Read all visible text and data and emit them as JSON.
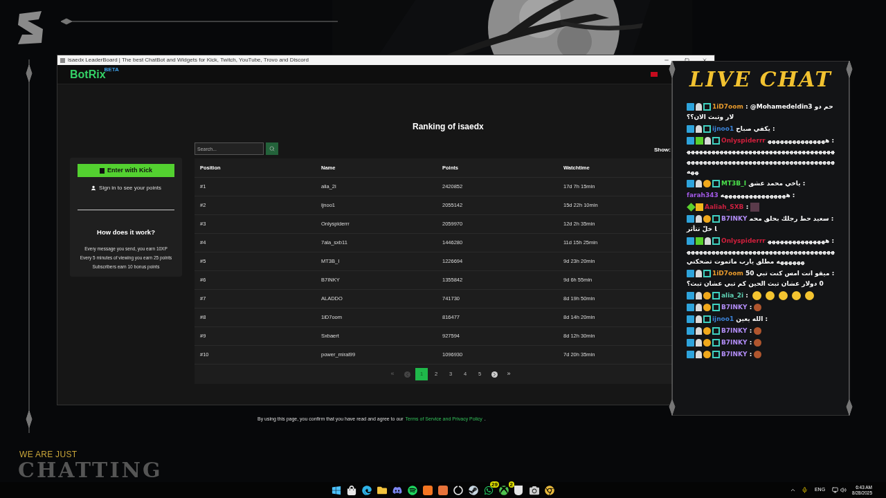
{
  "overlay": {
    "tagline": "WE ARE JUST",
    "title": "CHATTING"
  },
  "browser": {
    "title": "isaedx LeaderBoard | The best ChatBot and Widgets for Kick, Twitch, YouTube, Trovo and Discord",
    "logo": "BotRix",
    "logo_badge": "BETA"
  },
  "sidebar": {
    "login_button": "Enter with Kick",
    "sign_in": "Sign in to see your points",
    "heading": "How does it work?",
    "rules": [
      "Every message you send, you earn 10XP",
      "Every 5 minutes of viewing you earn 25 points",
      "Subscribers earn 10 bonus points"
    ]
  },
  "ranking": {
    "title": "Ranking of isaedx",
    "search": {
      "placeholder": "Search..."
    },
    "show_label": "Show:",
    "columns": [
      "Position",
      "Name",
      "Points",
      "Watchtime"
    ],
    "rows": [
      [
        "#1",
        "alia_2i",
        "2420852",
        "17d 7h 15min"
      ],
      [
        "#2",
        "ijnoo1",
        "2055142",
        "15d 22h 10min"
      ],
      [
        "#3",
        "Onlyspiderrr",
        "2059970",
        "12d 2h 35min"
      ],
      [
        "#4",
        "7ala_sxb11",
        "1446280",
        "11d 15h 25min"
      ],
      [
        "#5",
        "MT3B_I",
        "1226694",
        "9d 23h 20min"
      ],
      [
        "#6",
        "B7INKY",
        "1355842",
        "9d 6h 55min"
      ],
      [
        "#7",
        "ALADDO",
        "741730",
        "8d 19h 50min"
      ],
      [
        "#8",
        "1iD7oom",
        "816477",
        "8d 14h 20min"
      ],
      [
        "#9",
        "Sxbaert",
        "927594",
        "8d 12h 30min"
      ],
      [
        "#10",
        "power_miral99",
        "1096930",
        "7d 20h 35min"
      ]
    ],
    "pagination": {
      "first": "«",
      "last": "»",
      "prev_disabled": true,
      "next_disabled": false,
      "pages": [
        {
          "label": "1",
          "selected": true
        },
        {
          "label": "2",
          "selected": false
        },
        {
          "label": "3",
          "selected": false
        },
        {
          "label": "4",
          "selected": false
        },
        {
          "label": "5",
          "selected": false
        }
      ]
    }
  },
  "footer": {
    "text": "By using this page, you confirm that you have read and agree to our",
    "link": "Terms of Service and Privacy Policy",
    "end": "."
  },
  "chat": {
    "title": "LIVE CHAT",
    "messages": [
      {
        "badges": [
          {
            "kind": "mod"
          },
          {
            "kind": "sub"
          },
          {
            "kind": "og"
          }
        ],
        "user": "1iD7oom",
        "color": "#e89a2c",
        "text": ": @Mohamedeldin3 حم دولار وتبث الان؟؟"
      },
      {
        "badges": [
          {
            "kind": "mod"
          },
          {
            "kind": "sub"
          },
          {
            "kind": "og"
          }
        ],
        "user": "ijnoo1",
        "color": "#3b82d6",
        "text": ": يكفي صباح"
      },
      {
        "badges": [
          {
            "kind": "mod"
          },
          {
            "kind": "gift"
          },
          {
            "kind": "sub"
          },
          {
            "kind": "og"
          }
        ],
        "user": "Onlyspiderrr",
        "color": "#d11f3c",
        "text": ": هههههههههههههههههههههههههههههههههههههههههههههههههههههههههههههههههههههههههههههههههههههههههه"
      },
      {
        "badges": [
          {
            "kind": "mod"
          },
          {
            "kind": "sub"
          },
          {
            "kind": "tier"
          },
          {
            "kind": "og"
          }
        ],
        "user": "MT3B_I",
        "color": "#4ade4a",
        "text": ": ياخي محمد عشق"
      },
      {
        "user": "farah343",
        "color": "#a259e6",
        "text": ": ههههههههههههههههه"
      },
      {
        "badges": [
          {
            "kind": "vip"
          },
          {
            "kind": "crown"
          }
        ],
        "user": "Aaliah_SXB",
        "color": "#c8203f",
        "text": ":",
        "emotes": [
          {
            "kind": "pixel"
          }
        ]
      },
      {
        "badges": [
          {
            "kind": "mod"
          },
          {
            "kind": "sub"
          },
          {
            "kind": "tier"
          },
          {
            "kind": "og"
          }
        ],
        "user": "B7INKY",
        "color": "#b18cf5",
        "text": ": سعيد حط رجلك بحلق محما خلّ تتأثر"
      },
      {
        "badges": [
          {
            "kind": "mod"
          },
          {
            "kind": "gift"
          },
          {
            "kind": "sub"
          },
          {
            "kind": "og"
          }
        ],
        "user": "Onlyspiderrr",
        "color": "#d11f3c",
        "text": ": هههههههههههههههههههههههههههههههههههههههههههههههههههههههههه مطلق يارب ماتموت تضحكني"
      },
      {
        "badges": [
          {
            "kind": "mod"
          },
          {
            "kind": "sub"
          },
          {
            "kind": "og"
          }
        ],
        "user": "1iD7oom",
        "color": "#e89a2c",
        "text": ": ميقو انت امس كنت تبي 500 دولار عشان تبث الحين كم تبي عشان تبث؟"
      },
      {
        "badges": [
          {
            "kind": "mod"
          },
          {
            "kind": "sub"
          },
          {
            "kind": "tier"
          },
          {
            "kind": "og"
          }
        ],
        "user": "alia_2i",
        "color": "#5fd3b5",
        "text": ":",
        "emotes": [
          {
            "kind": "hug"
          },
          {
            "kind": "hug"
          },
          {
            "kind": "hug"
          },
          {
            "kind": "hug"
          },
          {
            "kind": "hug"
          }
        ]
      },
      {
        "badges": [
          {
            "kind": "mod"
          },
          {
            "kind": "sub"
          },
          {
            "kind": "tier"
          },
          {
            "kind": "og"
          }
        ],
        "user": "B7INKY",
        "color": "#b18cf5",
        "text": ":",
        "emotes": [
          {
            "kind": "sticker"
          }
        ]
      },
      {
        "badges": [
          {
            "kind": "mod"
          },
          {
            "kind": "sub"
          },
          {
            "kind": "og"
          }
        ],
        "user": "ijnoo1",
        "color": "#3b82d6",
        "text": ": الله يعين"
      },
      {
        "badges": [
          {
            "kind": "mod"
          },
          {
            "kind": "sub"
          },
          {
            "kind": "tier"
          },
          {
            "kind": "og"
          }
        ],
        "user": "B7INKY",
        "color": "#b18cf5",
        "text": ":",
        "emotes": [
          {
            "kind": "sticker"
          }
        ]
      },
      {
        "badges": [
          {
            "kind": "mod"
          },
          {
            "kind": "sub"
          },
          {
            "kind": "tier"
          },
          {
            "kind": "og"
          }
        ],
        "user": "B7INKY",
        "color": "#b18cf5",
        "text": ":",
        "emotes": [
          {
            "kind": "sticker"
          }
        ]
      },
      {
        "badges": [
          {
            "kind": "mod"
          },
          {
            "kind": "sub"
          },
          {
            "kind": "tier"
          },
          {
            "kind": "og"
          }
        ],
        "user": "B7INKY",
        "color": "#b18cf5",
        "text": ":",
        "emotes": [
          {
            "kind": "sticker"
          }
        ]
      }
    ]
  },
  "taskbar": {
    "apps": [
      {
        "kind": "start"
      },
      {
        "kind": "store"
      },
      {
        "kind": "edge"
      },
      {
        "kind": "folder"
      },
      {
        "kind": "discord"
      },
      {
        "kind": "spotify"
      },
      {
        "kind": "crunchy"
      },
      {
        "kind": "triangle"
      },
      {
        "kind": "obs"
      },
      {
        "kind": "steam"
      },
      {
        "kind": "whatsapp",
        "badge": "29"
      },
      {
        "kind": "xbox",
        "badge": "2"
      },
      {
        "kind": "epic"
      },
      {
        "kind": "camera"
      },
      {
        "kind": "chrome"
      }
    ],
    "language": "ENG",
    "time": "6:43 AM",
    "date": "8/28/2025"
  }
}
